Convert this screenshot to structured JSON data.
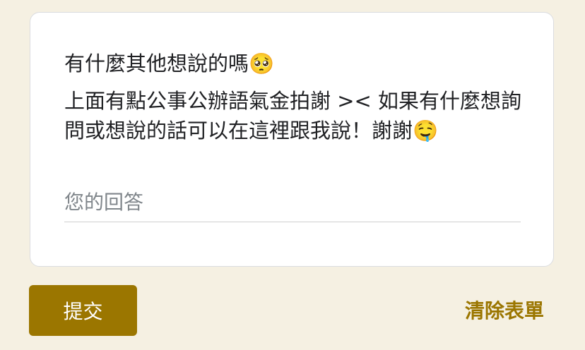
{
  "question": {
    "title": "有什麼其他想說的嗎🥺",
    "description": "上面有點公事公辦語氣金拍謝 >< 如果有什麼想詢問或想說的話可以在這裡跟我說！謝謝🤤"
  },
  "answer": {
    "placeholder": "您的回答",
    "value": ""
  },
  "actions": {
    "submit_label": "提交",
    "clear_label": "清除表單"
  },
  "colors": {
    "background": "#f5f0e2",
    "accent": "#9b7600",
    "card": "#ffffff"
  }
}
